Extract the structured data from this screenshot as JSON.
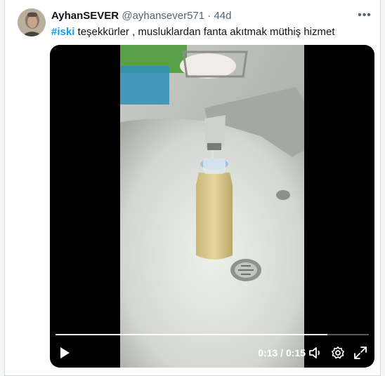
{
  "tweet": {
    "author_name": "AyhanSEVER",
    "author_handle": "@ayhansever571",
    "separator": "·",
    "time": "44d",
    "hashtag": "#iski",
    "text": " teşekkürler , musluklardan fanta akıtmak müthiş hizmet",
    "more_label": "•••"
  },
  "video": {
    "current_time": "0:13",
    "duration": "0:15",
    "time_separator": " / ",
    "progress": 0.867
  },
  "icons": {
    "avatar": "avatar-image",
    "more": "more-options-icon",
    "play": "play-icon",
    "volume": "volume-icon",
    "settings": "gear-icon",
    "fullscreen": "fullscreen-icon"
  },
  "colors": {
    "hashtag": "#1d9bf0",
    "name": "#0f1419",
    "secondary": "#536471"
  }
}
